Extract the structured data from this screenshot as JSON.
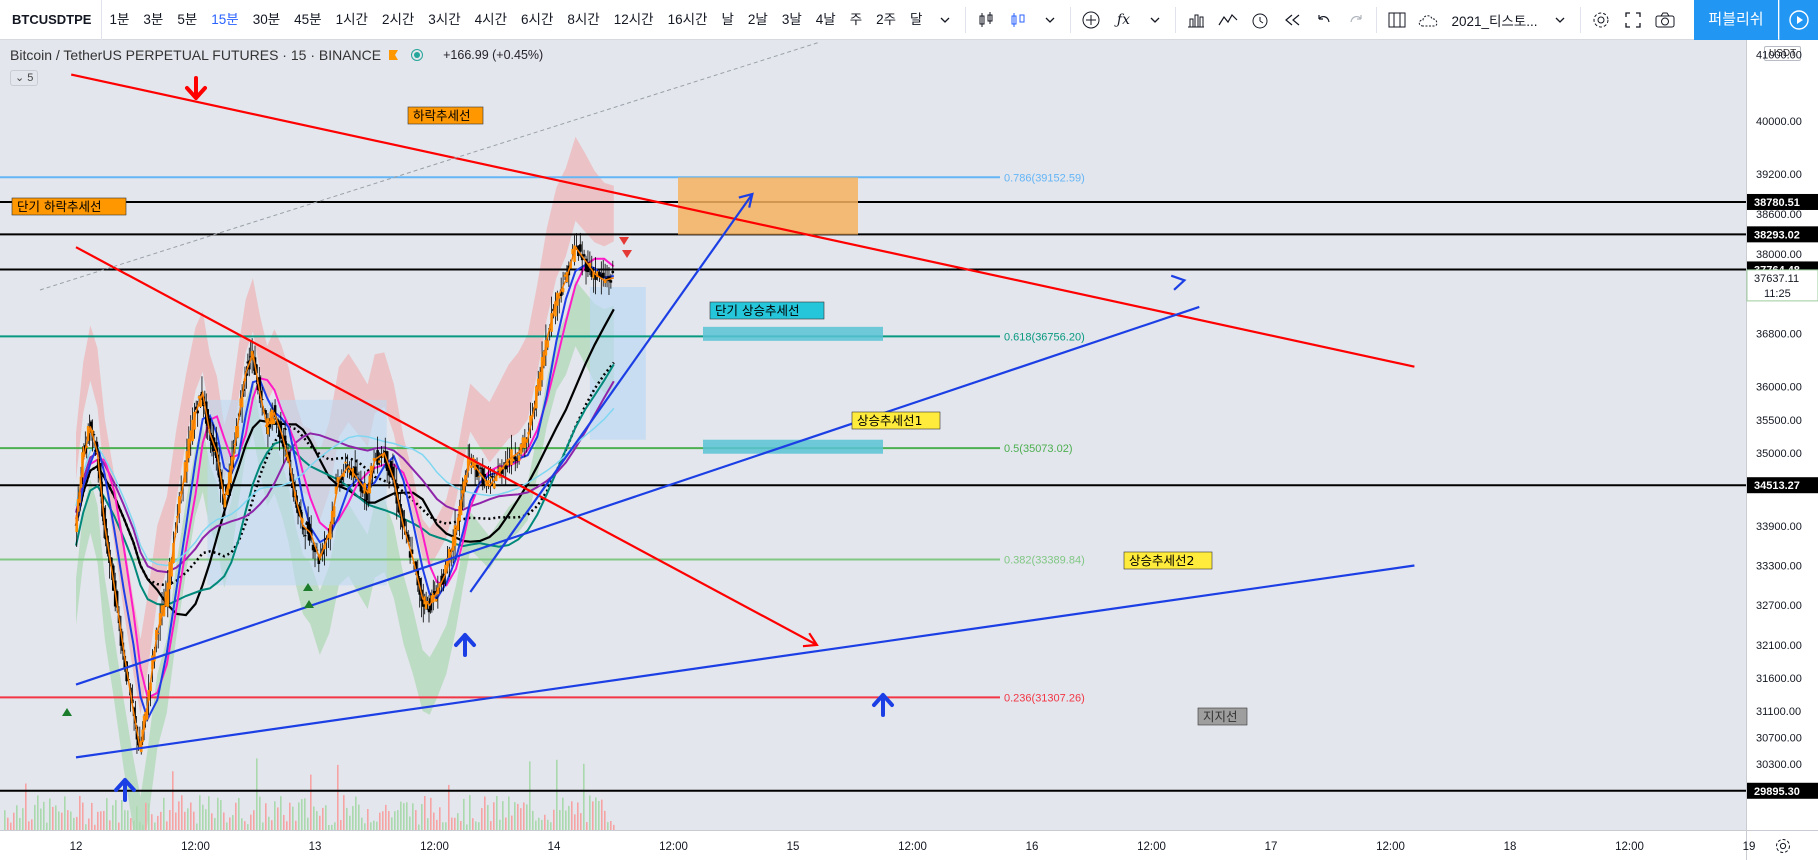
{
  "toolbar": {
    "symbol": "BTCUSDTPE",
    "intervals": [
      "1분",
      "3분",
      "5분",
      "15분",
      "30분",
      "45분",
      "1시간",
      "2시간",
      "3시간",
      "4시간",
      "6시간",
      "8시간",
      "12시간",
      "16시간",
      "날",
      "2날",
      "3날",
      "4날",
      "주",
      "2주",
      "달"
    ],
    "active_interval": "15분",
    "layout_name": "2021_티스토...",
    "publish_label": "퍼블리쉬",
    "icons": [
      "chevron-down-icon",
      "candles-icon",
      "bar-style-icon",
      "add-indicator-icon",
      "formula-icon",
      "bars-chart-icon",
      "indicators-icon",
      "alert-icon",
      "replay-icon",
      "undo-icon",
      "redo-icon",
      "layout-icon",
      "cloud-icon",
      "gear-icon",
      "fullscreen-icon",
      "camera-icon",
      "play-icon"
    ]
  },
  "legend": {
    "title": "Bitcoin / TetherUS PERPETUAL FUTURES · 15 · BINANCE",
    "change": "+166.99 (+0.45%)",
    "indicator_count": "5"
  },
  "price_axis": {
    "currency": "USDT",
    "ticks": [
      41000,
      40000,
      39200,
      38600,
      38000,
      37400,
      36800,
      36000,
      35500,
      35000,
      34500,
      33900,
      33300,
      32700,
      32100,
      31600,
      31100,
      30700,
      30300
    ],
    "tick_labels": [
      "41000.00",
      "40000.00",
      "39200.00",
      "38600.00",
      "38000.00",
      "37400.00",
      "36800.00",
      "36000.00",
      "35500.00",
      "35000.00",
      "34500.00",
      "33900.00",
      "33300.00",
      "32700.00",
      "32100.00",
      "31600.00",
      "31100.00",
      "30700.00",
      "30300.00"
    ],
    "current_price": "37637.11",
    "countdown": "11:25"
  },
  "time_axis": {
    "labels": [
      "12",
      "12:00",
      "13",
      "12:00",
      "14",
      "12:00",
      "15",
      "12:00",
      "16",
      "12:00",
      "17",
      "12:00",
      "18",
      "12:00",
      "19"
    ]
  },
  "chart_data": {
    "type": "line",
    "x_labels": [
      "12",
      "12:00",
      "13",
      "12:00",
      "14",
      "12:00",
      "15",
      "12:00",
      "16",
      "12:00",
      "17",
      "12:00",
      "18",
      "12:00",
      "19"
    ],
    "ylim": [
      29700,
      41200
    ],
    "close_series": [
      {
        "t": 0.0,
        "p": 33900
      },
      {
        "t": 0.03,
        "p": 34900
      },
      {
        "t": 0.06,
        "p": 35400
      },
      {
        "t": 0.09,
        "p": 35000
      },
      {
        "t": 0.12,
        "p": 33900
      },
      {
        "t": 0.16,
        "p": 33000
      },
      {
        "t": 0.2,
        "p": 32000
      },
      {
        "t": 0.24,
        "p": 31100
      },
      {
        "t": 0.27,
        "p": 30500
      },
      {
        "t": 0.3,
        "p": 31200
      },
      {
        "t": 0.34,
        "p": 32300
      },
      {
        "t": 0.38,
        "p": 32800
      },
      {
        "t": 0.42,
        "p": 33900
      },
      {
        "t": 0.46,
        "p": 34800
      },
      {
        "t": 0.5,
        "p": 35600
      },
      {
        "t": 0.53,
        "p": 35900
      },
      {
        "t": 0.56,
        "p": 35300
      },
      {
        "t": 0.59,
        "p": 35000
      },
      {
        "t": 0.62,
        "p": 34300
      },
      {
        "t": 0.65,
        "p": 34700
      },
      {
        "t": 0.68,
        "p": 35500
      },
      {
        "t": 0.71,
        "p": 36200
      },
      {
        "t": 0.74,
        "p": 36500
      },
      {
        "t": 0.77,
        "p": 35900
      },
      {
        "t": 0.8,
        "p": 35400
      },
      {
        "t": 0.83,
        "p": 35600
      },
      {
        "t": 0.86,
        "p": 35300
      },
      {
        "t": 0.89,
        "p": 34900
      },
      {
        "t": 0.92,
        "p": 34300
      },
      {
        "t": 0.95,
        "p": 33900
      },
      {
        "t": 0.98,
        "p": 33800
      },
      {
        "t": 1.02,
        "p": 33400
      },
      {
        "t": 1.06,
        "p": 33800
      },
      {
        "t": 1.1,
        "p": 34600
      },
      {
        "t": 1.14,
        "p": 34800
      },
      {
        "t": 1.18,
        "p": 34600
      },
      {
        "t": 1.22,
        "p": 34400
      },
      {
        "t": 1.25,
        "p": 34900
      },
      {
        "t": 1.29,
        "p": 35000
      },
      {
        "t": 1.33,
        "p": 34600
      },
      {
        "t": 1.37,
        "p": 33900
      },
      {
        "t": 1.41,
        "p": 33400
      },
      {
        "t": 1.45,
        "p": 32800
      },
      {
        "t": 1.48,
        "p": 32700
      },
      {
        "t": 1.51,
        "p": 32900
      },
      {
        "t": 1.55,
        "p": 33200
      },
      {
        "t": 1.59,
        "p": 33800
      },
      {
        "t": 1.62,
        "p": 34400
      },
      {
        "t": 1.65,
        "p": 34900
      },
      {
        "t": 1.69,
        "p": 34700
      },
      {
        "t": 1.73,
        "p": 34500
      },
      {
        "t": 1.77,
        "p": 34700
      },
      {
        "t": 1.81,
        "p": 34900
      },
      {
        "t": 1.85,
        "p": 35000
      },
      {
        "t": 1.89,
        "p": 35200
      },
      {
        "t": 1.93,
        "p": 35900
      },
      {
        "t": 1.97,
        "p": 36700
      },
      {
        "t": 2.01,
        "p": 37300
      },
      {
        "t": 2.05,
        "p": 37600
      },
      {
        "t": 2.09,
        "p": 38100
      },
      {
        "t": 2.13,
        "p": 37900
      },
      {
        "t": 2.17,
        "p": 37700
      },
      {
        "t": 2.21,
        "p": 37600
      },
      {
        "t": 2.25,
        "p": 37637
      }
    ],
    "horizontal_levels": [
      38780.51,
      38293.02,
      37764.48,
      34513.27,
      29895.3
    ],
    "horizontal_level_labels": [
      "38780.51",
      "38293.02",
      "37764.48",
      "34513.27",
      "29895.30"
    ],
    "fibonacci": [
      {
        "label": "0.786(39152.59)",
        "price": 39152.59,
        "color": "#64b5f6"
      },
      {
        "label": "0.618(36756.20)",
        "price": 36756.2,
        "color": "#089981"
      },
      {
        "label": "0.5(35073.02)",
        "price": 35073.02,
        "color": "#4caf50"
      },
      {
        "label": "0.382(33389.84)",
        "price": 33389.84,
        "color": "#81c784"
      },
      {
        "label": "0.236(31307.26)",
        "price": 31307.26,
        "color": "#f23645"
      }
    ],
    "trendlines": [
      {
        "name": "하락추세선",
        "color": "#ff0000",
        "from": [
          -0.02,
          40700
        ],
        "to": [
          5.6,
          36300
        ]
      },
      {
        "name": "단기 하락추세선",
        "color": "#ff0000",
        "from": [
          0.0,
          38100
        ],
        "to": [
          3.1,
          32100
        ]
      },
      {
        "name": "상승추세선1",
        "color": "#1c3fe5",
        "from": [
          0.0,
          31500
        ],
        "to": [
          4.7,
          37200
        ]
      },
      {
        "name": "상승추세선2",
        "color": "#1c3fe5",
        "from": [
          0.0,
          30400
        ],
        "to": [
          5.6,
          33300
        ]
      },
      {
        "name": "단기 상승추세선",
        "color": "#1c3fe5",
        "from": [
          1.65,
          32900
        ],
        "to": [
          2.83,
          38900
        ]
      }
    ],
    "annotations": [
      "하락추세선",
      "단기 하락추세선",
      "단기 상승추세선",
      "상승추세선1",
      "상승추세선2",
      "지지선"
    ]
  }
}
